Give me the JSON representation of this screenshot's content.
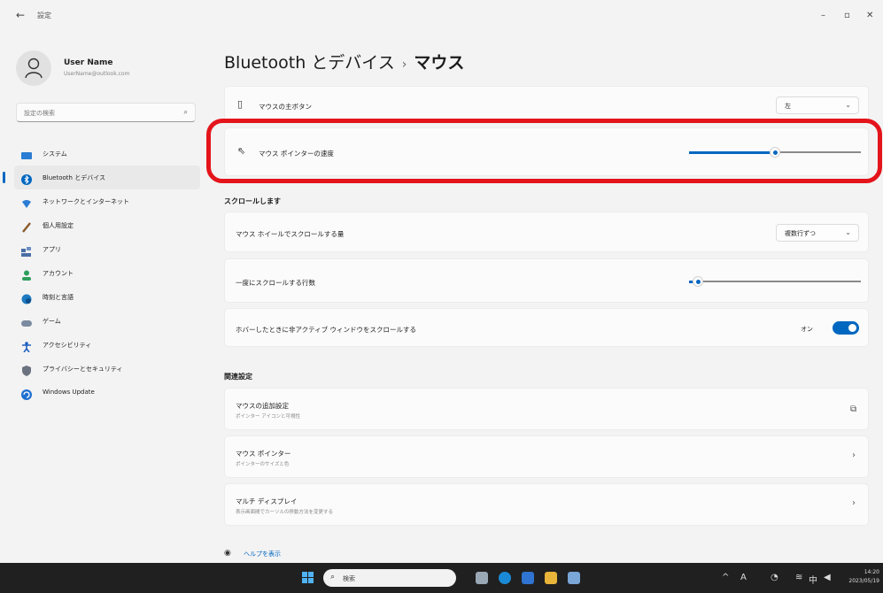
{
  "window": {
    "back_label": "←",
    "app_title": "設定",
    "controls": {
      "minimize": "–",
      "maximize": "▫",
      "close": "✕"
    }
  },
  "user": {
    "name": "User Name",
    "email": "UserName@outlook.com"
  },
  "search": {
    "placeholder": "設定の検索"
  },
  "sidebar": {
    "items": [
      {
        "label": "システム",
        "icon": "monitor-icon",
        "color": "#2b7cd3"
      },
      {
        "label": "Bluetooth とデバイス",
        "icon": "bluetooth-icon",
        "color": "#0067c0",
        "active": true
      },
      {
        "label": "ネットワークとインターネット",
        "icon": "wifi-icon",
        "color": "#2b7cd3"
      },
      {
        "label": "個人用設定",
        "icon": "brush-icon",
        "color": "#8a5a2b"
      },
      {
        "label": "アプリ",
        "icon": "apps-icon",
        "color": "#4a6fa5"
      },
      {
        "label": "アカウント",
        "icon": "person-icon",
        "color": "#2e9e5b"
      },
      {
        "label": "時刻と言語",
        "icon": "globe-clock-icon",
        "color": "#1f7ac2"
      },
      {
        "label": "ゲーム",
        "icon": "gamepad-icon",
        "color": "#7a8aa0"
      },
      {
        "label": "アクセシビリティ",
        "icon": "accessibility-icon",
        "color": "#1f5fbf"
      },
      {
        "label": "プライバシーとセキュリティ",
        "icon": "shield-icon",
        "color": "#6b7280"
      },
      {
        "label": "Windows Update",
        "icon": "update-icon",
        "color": "#1f6fd0"
      }
    ]
  },
  "breadcrumb": {
    "parent": "Bluetooth とデバイス",
    "separator": "›",
    "current": "マウス"
  },
  "primary_button": {
    "label": "マウスの主ボタン",
    "value": "左"
  },
  "pointer_speed": {
    "label": "マウス ポインターの速度",
    "value_fraction": 0.5
  },
  "scroll_section": {
    "heading": "スクロールします",
    "wheel_amount": {
      "label": "マウス ホイールでスクロールする量",
      "value": "複数行ずつ"
    },
    "lines": {
      "label": "一度にスクロールする行数",
      "value_fraction": 0.05
    },
    "inactive_scroll": {
      "label": "ホバーしたときに非アクティブ ウィンドウをスクロールする",
      "state": "オン"
    }
  },
  "related_section": {
    "heading": "関連設定",
    "items": [
      {
        "title": "マウスの追加設定",
        "subtitle": "ポインター アイコンと可視性",
        "trail": "⧉"
      },
      {
        "title": "マウス ポインター",
        "subtitle": "ポインターのサイズと色",
        "trail": "›"
      },
      {
        "title": "マルチ ディスプレイ",
        "subtitle": "表示画面間でカーソルの移動方法を変更する",
        "trail": "›"
      }
    ]
  },
  "help": {
    "label": "ヘルプを表示"
  },
  "taskbar": {
    "search_placeholder": "検索",
    "tray": {
      "chevron": "^",
      "ime": "A",
      "lang": "中"
    },
    "clock_time": "14:20",
    "clock_date": "2023/05/19"
  },
  "colors": {
    "accent": "#0067c0",
    "highlight_ring": "#e4141b"
  }
}
